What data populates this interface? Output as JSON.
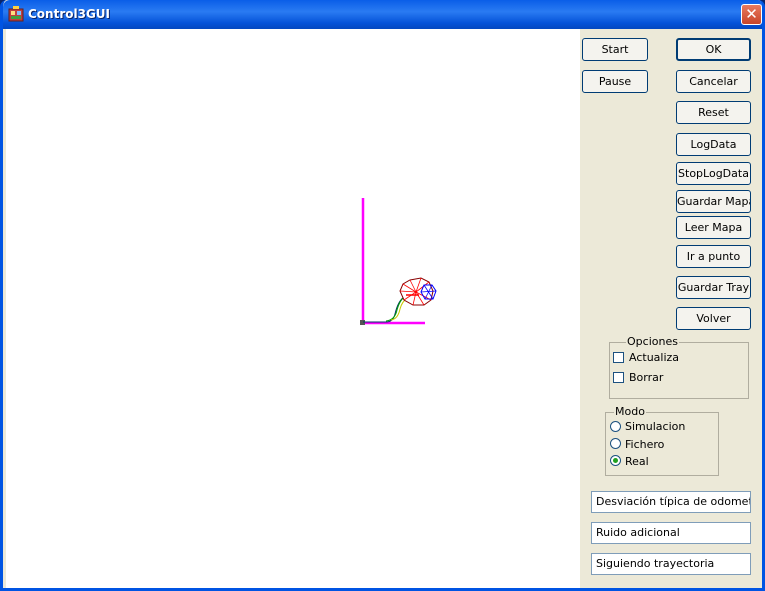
{
  "window": {
    "title": "Control3GUI",
    "close_glyph": "✕"
  },
  "buttons": {
    "start": "Start",
    "pause": "Pause",
    "ok": "OK",
    "cancelar": "Cancelar",
    "reset": "Reset",
    "logdata": "LogData",
    "stoplogdata": "StopLogData",
    "guardar_mapa": "Guardar Mapa",
    "leer_mapa": "Leer Mapa",
    "ir_a_punto": "Ir a punto",
    "guardar_tray": "Guardar Tray",
    "volver": "Volver"
  },
  "opciones": {
    "label": "Opciones",
    "actualiza": {
      "label": "Actualiza",
      "checked": false
    },
    "borrar": {
      "label": "Borrar",
      "checked": false
    }
  },
  "modo": {
    "label": "Modo",
    "options": [
      {
        "label": "Simulacion",
        "selected": false
      },
      {
        "label": "Fichero",
        "selected": false
      },
      {
        "label": "Real",
        "selected": true
      }
    ]
  },
  "status_fields": {
    "odometria": "Desviación típica de odometría",
    "ruido": "Ruido adicional",
    "trayectoria": "Siguiendo trayectoria"
  },
  "colors": {
    "axis": "#ff00ff",
    "robot_outline": "#880000",
    "robot_rays": "#ff0000",
    "sensor": "#0000ff",
    "trajectory_dark": "#003366",
    "trajectory_green": "#00a000",
    "trajectory_yellow": "#c8c800"
  }
}
